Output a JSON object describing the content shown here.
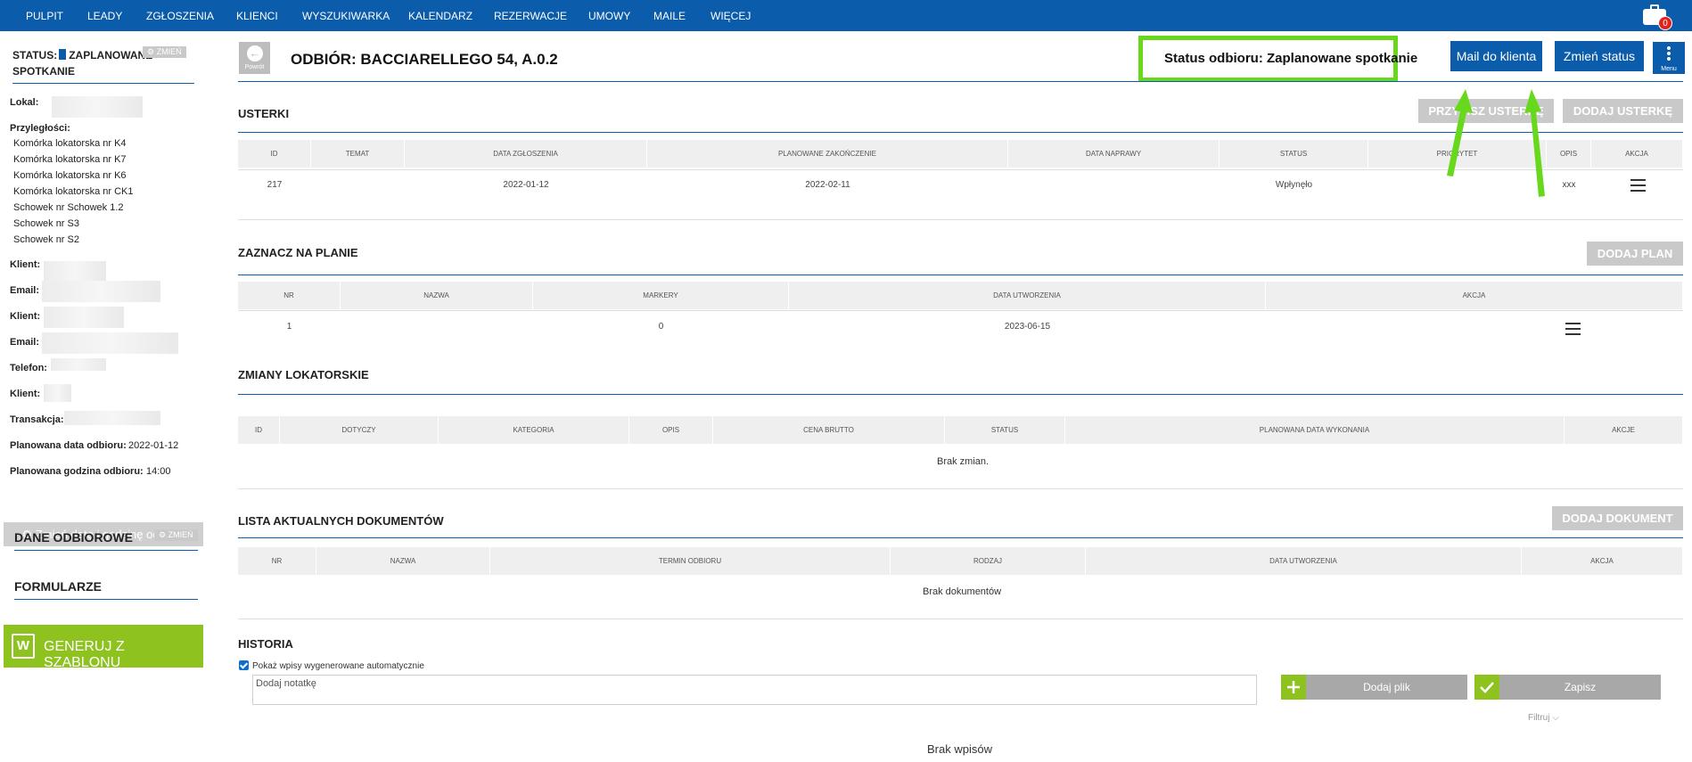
{
  "nav": {
    "items": [
      "PULPIT",
      "LEADY",
      "ZGŁOSZENIA",
      "KLIENCI",
      "WYSZUKIWARKA",
      "KALENDARZ",
      "REZERWACJE",
      "UMOWY",
      "MAILE",
      "WIĘCEJ"
    ],
    "notifications_count": "0"
  },
  "sidebar": {
    "status_label": "STATUS:",
    "status_value": "ZAPLANOWANE SPOTKANIE",
    "change_label": "ZMIEŃ",
    "lokal_label": "Lokal:",
    "przyleglosci_label": "Przyległości:",
    "przyleglosci": [
      "Komórka lokatorska nr K4",
      "Komórka lokatorska nr K7",
      "Komórka lokatorska nr K6",
      "Komórka lokatorska nr CK1",
      "Schowek nr Schowek 1.2",
      "Schowek nr S3",
      "Schowek nr S2"
    ],
    "klient_label": "Klient:",
    "email_label": "Email:",
    "telefon_label": "Telefon:",
    "transakcja_label": "Transakcja:",
    "data_odbioru_label": "Planowana data odbioru:",
    "data_odbioru_value": "2022-01-12",
    "godzina_odbioru_label": "Planowana godzina odbioru:",
    "godzina_odbioru_value": "14:00",
    "change_date_button": "Zmień datę i godzinę odbioru",
    "dane_odbiorowe": "DANE ODBIOROWE",
    "formularze": "FORMULARZE",
    "generate_button": "GENERUJ Z SZABLONU",
    "word_icon_letter": "W"
  },
  "header": {
    "back_label": "Powrót",
    "title": "ODBIÓR: BACCIARELLEGO 54, A.0.2",
    "status_text": "Status odbioru: Zaplanowane spotkanie",
    "mail_button": "Mail do klienta",
    "change_status_button": "Zmień status",
    "menu_label": "Menu"
  },
  "usterki": {
    "title": "USTERKI",
    "btn_przypisz": "PRZYPISZ USTERKĘ",
    "btn_dodaj": "DODAJ USTERKĘ",
    "columns": [
      "ID",
      "TEMAT",
      "DATA ZGŁOSZENIA",
      "PLANOWANE ZAKOŃCZENIE",
      "DATA NAPRAWY",
      "STATUS",
      "PRIORYTET",
      "OPIS",
      "AKCJA"
    ],
    "rows": [
      {
        "id": "217",
        "temat": "",
        "data_zgloszenia": "2022-01-12",
        "planowane": "2022-02-11",
        "data_naprawy": "",
        "status": "Wpłynęło",
        "priorytet": "",
        "opis": "xxx"
      }
    ]
  },
  "plan": {
    "title": "ZAZNACZ NA PLANIE",
    "btn_dodaj": "DODAJ PLAN",
    "columns": [
      "NR",
      "NAZWA",
      "MARKERY",
      "DATA UTWORZENIA",
      "AKCJA"
    ],
    "rows": [
      {
        "nr": "1",
        "nazwa": "",
        "markery": "0",
        "data": "2023-06-15"
      }
    ]
  },
  "zmiany": {
    "title": "ZMIANY LOKATORSKIE",
    "columns": [
      "ID",
      "DOTYCZY",
      "KATEGORIA",
      "OPIS",
      "CENA BRUTTO",
      "STATUS",
      "PLANOWANA DATA WYKONANIA",
      "AKCJE"
    ],
    "empty": "Brak zmian."
  },
  "dokumenty": {
    "title": "LISTA AKTUALNYCH DOKUMENTÓW",
    "btn_dodaj": "DODAJ DOKUMENT",
    "columns": [
      "NR",
      "NAZWA",
      "TERMIN ODBIORU",
      "RODZAJ",
      "DATA UTWORZENIA",
      "AKCJA"
    ],
    "empty": "Brak dokumentów"
  },
  "historia": {
    "title": "HISTORIA",
    "checkbox_label": "Pokaż wpisy wygenerowane automatycznie",
    "note_placeholder": "Dodaj notatkę",
    "btn_plik": "Dodaj plik",
    "btn_zapisz": "Zapisz",
    "filtruj": "Filtruj",
    "empty": "Brak wpisów"
  },
  "colors": {
    "brand_blue": "#0b5cab",
    "highlight_green": "#67d81c",
    "action_green": "#8dc21f",
    "disabled_gray": "#c9c9c9"
  }
}
